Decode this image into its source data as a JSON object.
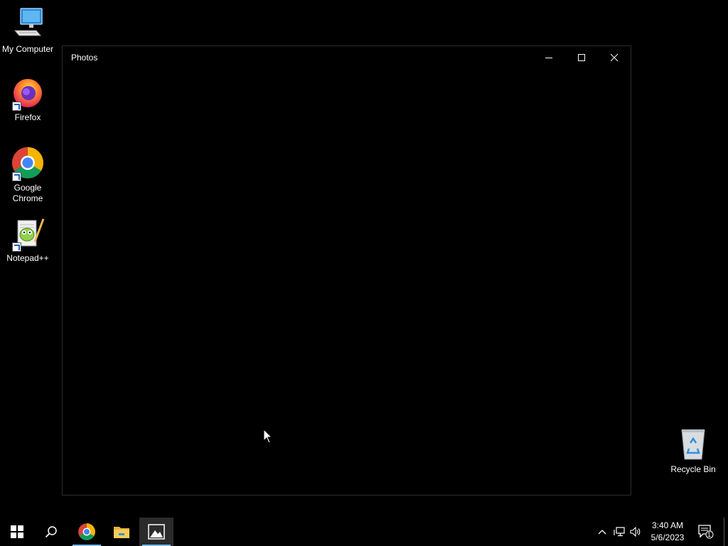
{
  "desktop": {
    "icons": [
      {
        "label": "My Computer",
        "icon": "computer-icon"
      },
      {
        "label": "Firefox",
        "icon": "firefox-icon"
      },
      {
        "label": "Google Chrome",
        "icon": "chrome-icon"
      },
      {
        "label": "Notepad++",
        "icon": "notepadpp-icon"
      },
      {
        "label": "Recycle Bin",
        "icon": "recycle-bin-icon"
      }
    ]
  },
  "window": {
    "title": "Photos",
    "controls": [
      "minimize-icon",
      "maximize-icon",
      "close-icon"
    ]
  },
  "taskbar": {
    "buttons": [
      "windows-start-icon",
      "search-icon",
      "chrome-icon",
      "file-explorer-icon",
      "photos-icon"
    ],
    "tray": [
      "chevron-up-icon",
      "network-icon",
      "volume-icon"
    ],
    "time": "3:40 AM",
    "date": "5/6/2023",
    "notifications_count": "1"
  },
  "colors": {
    "accent": "#76b9ed",
    "background": "#000000"
  }
}
